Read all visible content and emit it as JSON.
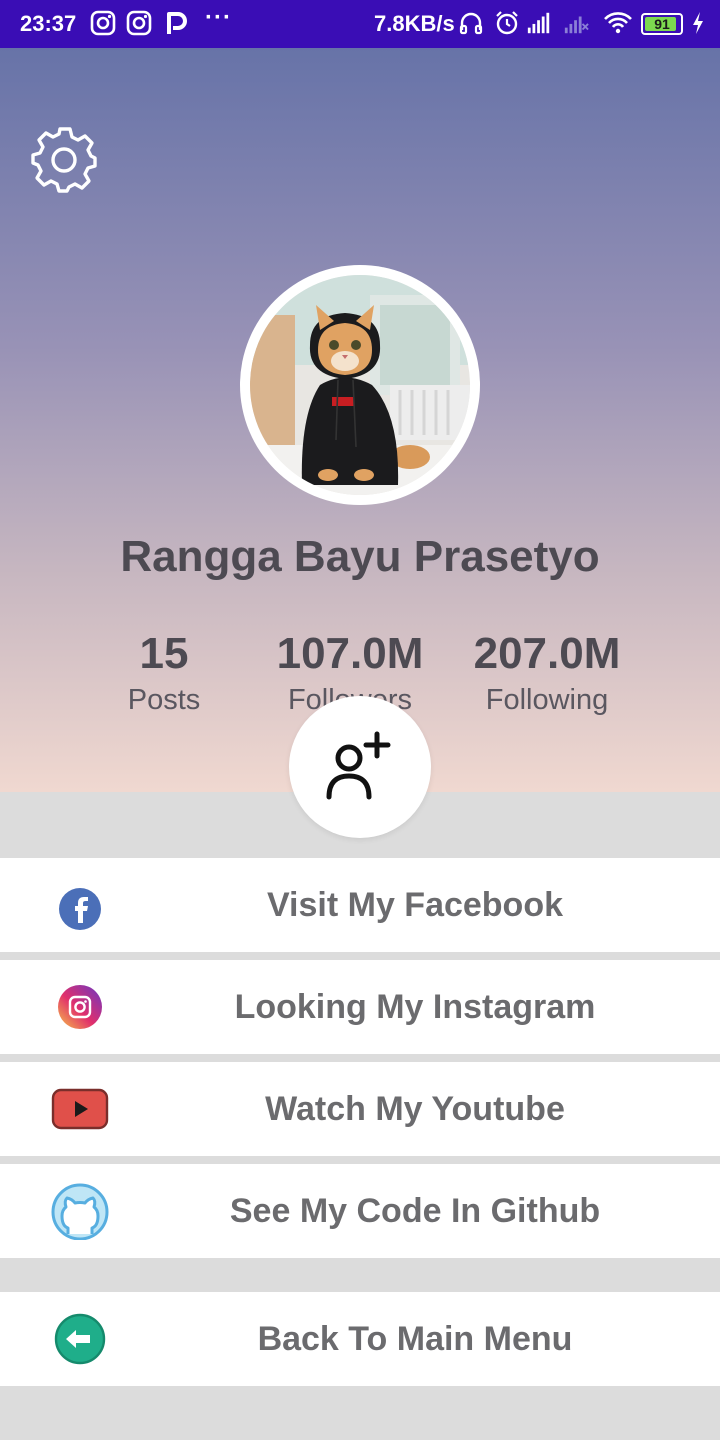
{
  "status_bar": {
    "time": "23:37",
    "notification_icons": [
      "instagram-icon",
      "instagram-icon",
      "p-app-icon"
    ],
    "more": "···",
    "speed": "7.8KB/s",
    "battery": "91",
    "battery_level": 0.91
  },
  "profile": {
    "name": "Rangga Bayu Prasetyo",
    "stats": [
      {
        "value": "15",
        "label": "Posts"
      },
      {
        "value": "107.0M",
        "label": "Followers"
      },
      {
        "value": "207.0M",
        "label": "Following"
      }
    ]
  },
  "links": [
    {
      "label": "Visit My Facebook",
      "icon": "facebook-icon"
    },
    {
      "label": "Looking My Instagram",
      "icon": "instagram-icon"
    },
    {
      "label": "Watch My Youtube",
      "icon": "youtube-icon"
    },
    {
      "label": "See My Code In Github",
      "icon": "github-icon"
    },
    {
      "label": "Back To Main Menu",
      "icon": "back-arrow-icon"
    }
  ],
  "colors": {
    "status_bar": "#3a0db5",
    "facebook": "#4b6fb8",
    "youtube": "#e0504a",
    "back": "#1fae8a"
  }
}
